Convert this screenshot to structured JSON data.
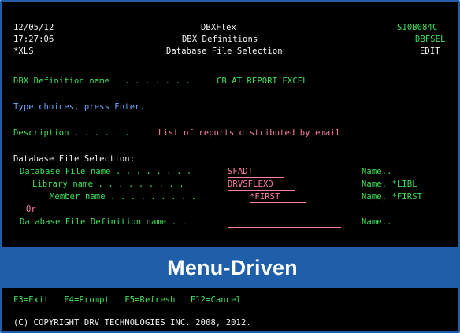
{
  "header": {
    "date": "12/05/12",
    "time": "17:27:06",
    "user_code": "*XLS",
    "app_name": "DBXFlex",
    "subtitle": "DBX Definitions",
    "screen_title": "Database File Selection",
    "system_name": "S10B084C",
    "program_name": "DBFSEL",
    "mode": "EDIT"
  },
  "definition": {
    "label": "DBX Definition name . . . . . . . .",
    "value": "CB AT REPORT EXCEL"
  },
  "instructions": "Type choices, press Enter.",
  "description": {
    "label": "Description . . . . . .",
    "value": "List of reports distributed by email"
  },
  "section_title": "Database File Selection:",
  "fields": {
    "database_file": {
      "label": "Database File name . . . . . . . .",
      "value": "SFADT",
      "hint": "Name.."
    },
    "library": {
      "label": "Library name . . . . . . . . .",
      "value": "DRVSFLEXD",
      "hint": "Name, *LIBL"
    },
    "member": {
      "label": "Member name . . . . . . . . .",
      "value": "*FIRST",
      "hint": "Name, *FIRST"
    },
    "or_label": "Or",
    "file_definition": {
      "label": "Database File Definition name . .",
      "value": "",
      "hint": "Name.."
    }
  },
  "banner": "Menu-Driven",
  "function_keys": "F3=Exit   F4=Prompt   F5=Refresh   F12=Cancel",
  "copyright": "(C) COPYRIGHT DRV TECHNOLOGIES INC. 2008, 2012.",
  "colors": {
    "background": "#000000",
    "frame_blue": "#1f5ea8",
    "green": "#3ee05a",
    "white": "#f4f4f4",
    "blue_text": "#6fa8ff",
    "pink_input": "#ff7fa6"
  }
}
